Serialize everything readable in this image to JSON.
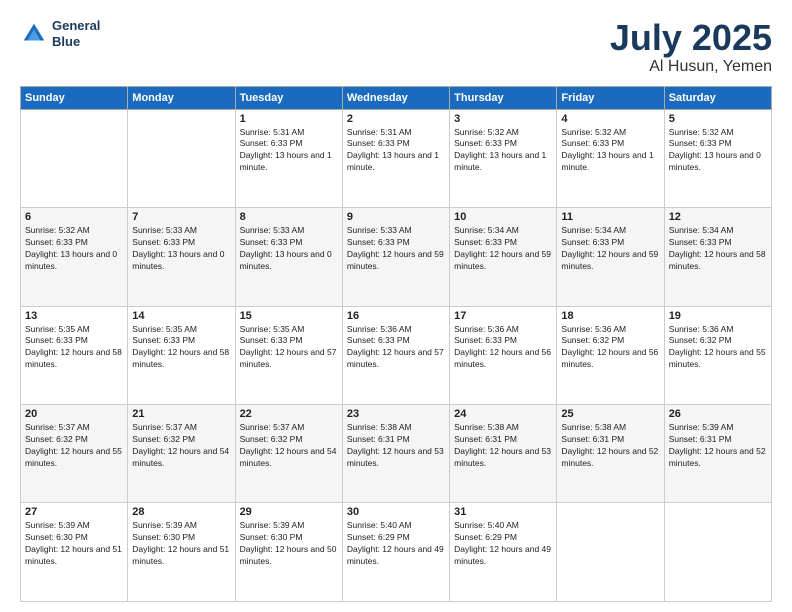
{
  "logo": {
    "line1": "General",
    "line2": "Blue"
  },
  "header": {
    "month": "July 2025",
    "location": "Al Husun, Yemen"
  },
  "days_of_week": [
    "Sunday",
    "Monday",
    "Tuesday",
    "Wednesday",
    "Thursday",
    "Friday",
    "Saturday"
  ],
  "weeks": [
    [
      {
        "day": "",
        "sunrise": "",
        "sunset": "",
        "daylight": ""
      },
      {
        "day": "",
        "sunrise": "",
        "sunset": "",
        "daylight": ""
      },
      {
        "day": "1",
        "sunrise": "Sunrise: 5:31 AM",
        "sunset": "Sunset: 6:33 PM",
        "daylight": "Daylight: 13 hours and 1 minute."
      },
      {
        "day": "2",
        "sunrise": "Sunrise: 5:31 AM",
        "sunset": "Sunset: 6:33 PM",
        "daylight": "Daylight: 13 hours and 1 minute."
      },
      {
        "day": "3",
        "sunrise": "Sunrise: 5:32 AM",
        "sunset": "Sunset: 6:33 PM",
        "daylight": "Daylight: 13 hours and 1 minute."
      },
      {
        "day": "4",
        "sunrise": "Sunrise: 5:32 AM",
        "sunset": "Sunset: 6:33 PM",
        "daylight": "Daylight: 13 hours and 1 minute."
      },
      {
        "day": "5",
        "sunrise": "Sunrise: 5:32 AM",
        "sunset": "Sunset: 6:33 PM",
        "daylight": "Daylight: 13 hours and 0 minutes."
      }
    ],
    [
      {
        "day": "6",
        "sunrise": "Sunrise: 5:32 AM",
        "sunset": "Sunset: 6:33 PM",
        "daylight": "Daylight: 13 hours and 0 minutes."
      },
      {
        "day": "7",
        "sunrise": "Sunrise: 5:33 AM",
        "sunset": "Sunset: 6:33 PM",
        "daylight": "Daylight: 13 hours and 0 minutes."
      },
      {
        "day": "8",
        "sunrise": "Sunrise: 5:33 AM",
        "sunset": "Sunset: 6:33 PM",
        "daylight": "Daylight: 13 hours and 0 minutes."
      },
      {
        "day": "9",
        "sunrise": "Sunrise: 5:33 AM",
        "sunset": "Sunset: 6:33 PM",
        "daylight": "Daylight: 12 hours and 59 minutes."
      },
      {
        "day": "10",
        "sunrise": "Sunrise: 5:34 AM",
        "sunset": "Sunset: 6:33 PM",
        "daylight": "Daylight: 12 hours and 59 minutes."
      },
      {
        "day": "11",
        "sunrise": "Sunrise: 5:34 AM",
        "sunset": "Sunset: 6:33 PM",
        "daylight": "Daylight: 12 hours and 59 minutes."
      },
      {
        "day": "12",
        "sunrise": "Sunrise: 5:34 AM",
        "sunset": "Sunset: 6:33 PM",
        "daylight": "Daylight: 12 hours and 58 minutes."
      }
    ],
    [
      {
        "day": "13",
        "sunrise": "Sunrise: 5:35 AM",
        "sunset": "Sunset: 6:33 PM",
        "daylight": "Daylight: 12 hours and 58 minutes."
      },
      {
        "day": "14",
        "sunrise": "Sunrise: 5:35 AM",
        "sunset": "Sunset: 6:33 PM",
        "daylight": "Daylight: 12 hours and 58 minutes."
      },
      {
        "day": "15",
        "sunrise": "Sunrise: 5:35 AM",
        "sunset": "Sunset: 6:33 PM",
        "daylight": "Daylight: 12 hours and 57 minutes."
      },
      {
        "day": "16",
        "sunrise": "Sunrise: 5:36 AM",
        "sunset": "Sunset: 6:33 PM",
        "daylight": "Daylight: 12 hours and 57 minutes."
      },
      {
        "day": "17",
        "sunrise": "Sunrise: 5:36 AM",
        "sunset": "Sunset: 6:33 PM",
        "daylight": "Daylight: 12 hours and 56 minutes."
      },
      {
        "day": "18",
        "sunrise": "Sunrise: 5:36 AM",
        "sunset": "Sunset: 6:32 PM",
        "daylight": "Daylight: 12 hours and 56 minutes."
      },
      {
        "day": "19",
        "sunrise": "Sunrise: 5:36 AM",
        "sunset": "Sunset: 6:32 PM",
        "daylight": "Daylight: 12 hours and 55 minutes."
      }
    ],
    [
      {
        "day": "20",
        "sunrise": "Sunrise: 5:37 AM",
        "sunset": "Sunset: 6:32 PM",
        "daylight": "Daylight: 12 hours and 55 minutes."
      },
      {
        "day": "21",
        "sunrise": "Sunrise: 5:37 AM",
        "sunset": "Sunset: 6:32 PM",
        "daylight": "Daylight: 12 hours and 54 minutes."
      },
      {
        "day": "22",
        "sunrise": "Sunrise: 5:37 AM",
        "sunset": "Sunset: 6:32 PM",
        "daylight": "Daylight: 12 hours and 54 minutes."
      },
      {
        "day": "23",
        "sunrise": "Sunrise: 5:38 AM",
        "sunset": "Sunset: 6:31 PM",
        "daylight": "Daylight: 12 hours and 53 minutes."
      },
      {
        "day": "24",
        "sunrise": "Sunrise: 5:38 AM",
        "sunset": "Sunset: 6:31 PM",
        "daylight": "Daylight: 12 hours and 53 minutes."
      },
      {
        "day": "25",
        "sunrise": "Sunrise: 5:38 AM",
        "sunset": "Sunset: 6:31 PM",
        "daylight": "Daylight: 12 hours and 52 minutes."
      },
      {
        "day": "26",
        "sunrise": "Sunrise: 5:39 AM",
        "sunset": "Sunset: 6:31 PM",
        "daylight": "Daylight: 12 hours and 52 minutes."
      }
    ],
    [
      {
        "day": "27",
        "sunrise": "Sunrise: 5:39 AM",
        "sunset": "Sunset: 6:30 PM",
        "daylight": "Daylight: 12 hours and 51 minutes."
      },
      {
        "day": "28",
        "sunrise": "Sunrise: 5:39 AM",
        "sunset": "Sunset: 6:30 PM",
        "daylight": "Daylight: 12 hours and 51 minutes."
      },
      {
        "day": "29",
        "sunrise": "Sunrise: 5:39 AM",
        "sunset": "Sunset: 6:30 PM",
        "daylight": "Daylight: 12 hours and 50 minutes."
      },
      {
        "day": "30",
        "sunrise": "Sunrise: 5:40 AM",
        "sunset": "Sunset: 6:29 PM",
        "daylight": "Daylight: 12 hours and 49 minutes."
      },
      {
        "day": "31",
        "sunrise": "Sunrise: 5:40 AM",
        "sunset": "Sunset: 6:29 PM",
        "daylight": "Daylight: 12 hours and 49 minutes."
      },
      {
        "day": "",
        "sunrise": "",
        "sunset": "",
        "daylight": ""
      },
      {
        "day": "",
        "sunrise": "",
        "sunset": "",
        "daylight": ""
      }
    ]
  ]
}
